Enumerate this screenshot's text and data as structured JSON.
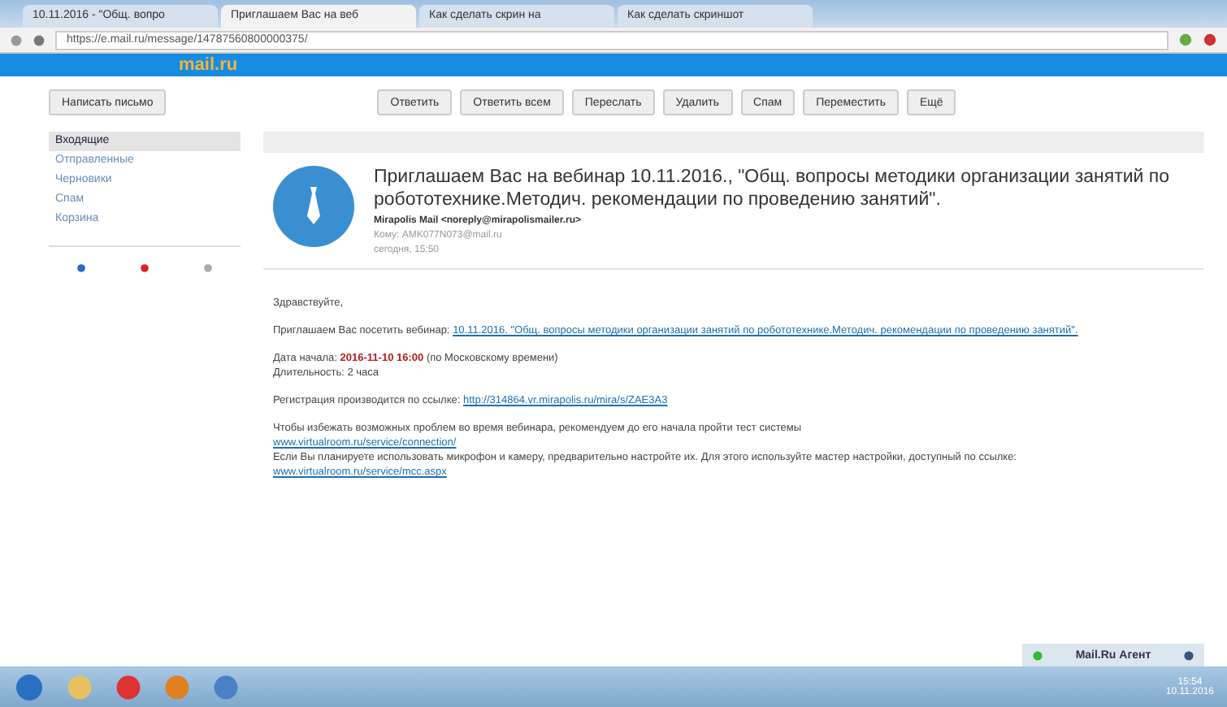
{
  "browser": {
    "tabs": [
      {
        "label": "10.11.2016 - \"Общ. вопро",
        "selected": false
      },
      {
        "label": "Приглашаем Вас на веб",
        "selected": true
      },
      {
        "label": "Как сделать скрин на",
        "selected": false
      },
      {
        "label": "Как сделать скриншот",
        "selected": false
      }
    ],
    "url": "https://e.mail.ru/message/14787560800000375/"
  },
  "mail": {
    "logo": "mail.ru",
    "toolbar": {
      "compose": "Написать письмо",
      "actions": [
        "Ответить",
        "Ответить всем",
        "Переслать",
        "Удалить",
        "Спам",
        "Переместить",
        "Ещё"
      ]
    },
    "folders": [
      {
        "label": "Входящие",
        "selected": true
      },
      {
        "label": "Отправленные",
        "selected": false
      },
      {
        "label": "Черновики",
        "selected": false
      },
      {
        "label": "Спам",
        "selected": false
      },
      {
        "label": "Корзина",
        "selected": false
      }
    ],
    "message": {
      "subject": "Приглашаем Вас на вебинар 10.11.2016., \"Общ. вопросы методики организации занятий по робототехнике.Методич. рекомендации по проведению занятий\".",
      "sender": "Mirapolis Mail <noreply@mirapolismailer.ru>",
      "to": "Кому: AMK077N073@mail.ru",
      "date": "сегодня, 15:50",
      "greeting": "Здравствуйте,",
      "invite_text": "Приглашаем Вас посетить вебинар:",
      "invite_link": "10.11.2016. \"Общ. вопросы методики организации занятий по робототехнике.Методич. рекомендации по проведению занятий\".",
      "start_label": "Дата начала:",
      "start_value": "2016-11-10 16:00",
      "start_note": "(по Московскому времени)",
      "duration": "Длительность: 2 часа",
      "reg_text": "Регистрация производится по ссылке:",
      "reg_link": "http://314864.vr.mirapolis.ru/mira/s/ZAE3A3",
      "check_text": "Чтобы избежать возможных проблем во время вебинара, рекомендуем до его начала пройти тест системы",
      "check_link": "www.virtualroom.ru/service/connection/",
      "setup_text": "Если Вы планируете использовать микрофон и камеру, предварительно настройте их. Для этого используйте мастер настройки, доступный по ссылке:",
      "setup_link": "www.virtualroom.ru/service/mcc.aspx"
    }
  },
  "agent": {
    "title": "Mail.Ru Агент"
  },
  "taskbar": {
    "time": "15:54",
    "date": "10.11.2016"
  }
}
